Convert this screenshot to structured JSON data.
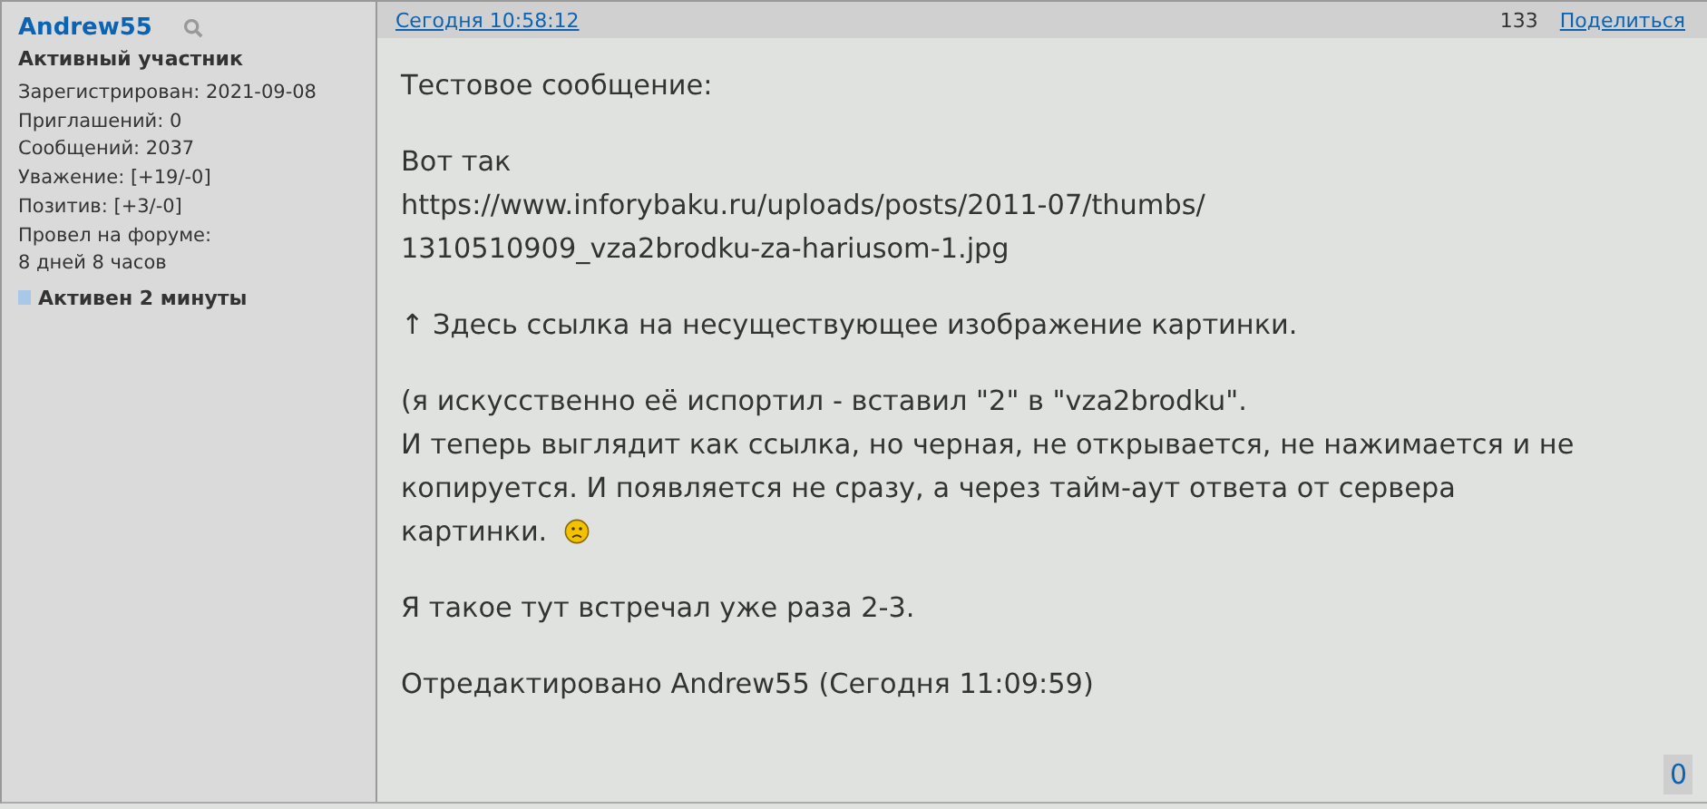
{
  "author": {
    "name": "Andrew55",
    "rank": "Активный участник",
    "stats": [
      "Зарегистрирован: 2021-09-08",
      "Приглашений: 0",
      "Сообщений: 2037",
      "Уважение: [+19/-0]",
      "Позитив: [+3/-0]",
      "Провел на форуме:",
      "8 дней 8 часов"
    ],
    "activity": "Активен 2 минуты"
  },
  "post": {
    "time": "Сегодня 10:58:12",
    "number": "133",
    "share": "Поделиться",
    "paragraphs": [
      {
        "lines": [
          "Тестовое сообщение:"
        ]
      },
      {
        "lines": [
          "Вот так",
          "https://www.inforybaku.ru/uploads/posts/2011-07/thumbs/",
          "1310510909_vza2brodku-za-hariusom-1.jpg"
        ]
      },
      {
        "lines": [
          "↑ Здесь ссылка на несуществующее изображение картинки."
        ]
      },
      {
        "lines": [
          "(я искусственно её испортил - вставил \"2\" в \"vza2brodku\".",
          "И теперь выглядит как ссылка, но черная, не открывается, не нажимается и не",
          "копируется. И появляется не сразу, а через тайм-аут ответа от сервера",
          "картинки."
        ],
        "sad_emoticon": true
      },
      {
        "lines": [
          "Я такое тут встречал уже раза 2-3."
        ]
      }
    ],
    "edited": "Отредактировано Andrew55 (Сегодня 11:09:59)",
    "likes": "0"
  }
}
